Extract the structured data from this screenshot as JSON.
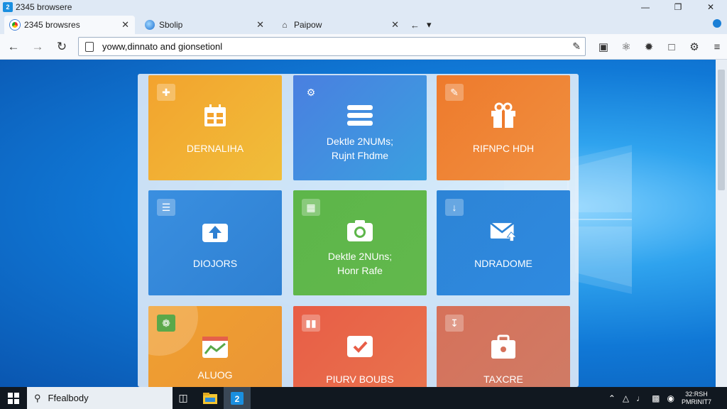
{
  "window": {
    "title": "2345 browsere"
  },
  "tabs": [
    {
      "label": "2345 browsres",
      "active": true,
      "icon": "chrome-icon"
    },
    {
      "label": "Sbolip",
      "active": false,
      "icon": "blue-orb-icon"
    },
    {
      "label": "Paipow",
      "active": false,
      "icon": "home-icon"
    }
  ],
  "address": {
    "value": "yoww,dinnato and gionsetionl"
  },
  "tiles": [
    {
      "label1": "DERNALIHA",
      "label2": "",
      "color": "#f0a92a",
      "icon": "calendar-icon",
      "corner_icon": "plus-box-icon"
    },
    {
      "label1": "Dektle 2NUMs;",
      "label2": "Rujnt Fhdme",
      "color": "#4a8ee0",
      "icon": "list-icon",
      "corner_icon": "gear-icon"
    },
    {
      "label1": "RIFNPC HDH",
      "label2": "",
      "color": "#ec7d2e",
      "icon": "gift-icon",
      "corner_icon": "pencil-icon"
    },
    {
      "label1": "DIOJORS",
      "label2": "",
      "color": "#2f8bdc",
      "icon": "upload-icon",
      "corner_icon": "sliders-icon"
    },
    {
      "label1": "Dektle 2NUns;",
      "label2": "Honr Rafe",
      "color": "#5cb34c",
      "icon": "camera-icon",
      "corner_icon": "grid-icon"
    },
    {
      "label1": "NDRADOME",
      "label2": "",
      "color": "#2e86d8",
      "icon": "mail-icon",
      "corner_icon": "download-icon"
    },
    {
      "label1": "ALUOG",
      "label2": "",
      "color": "#eb9a34",
      "icon": "chart-icon",
      "corner_icon": "leaf-icon"
    },
    {
      "label1": "PIURV BOUBS",
      "label2": "",
      "color": "#e5604a",
      "icon": "check-icon",
      "corner_icon": "book-icon"
    },
    {
      "label1": "TAXCRE",
      "label2": "",
      "color": "#d3735e",
      "icon": "briefcase-icon",
      "corner_icon": "doc-icon"
    }
  ],
  "taskbar": {
    "search_text": "Ffealbody",
    "clock_time": "32:RSH",
    "clock_date": "PMRINIT7"
  }
}
